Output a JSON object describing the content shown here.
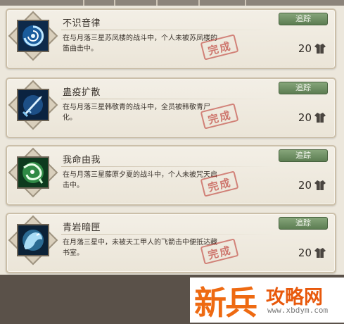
{
  "quests": [
    {
      "title": "不识音律",
      "description": "在与月落三星苏凤楼的战斗中，个人未被苏凤楼的笛曲击中。",
      "track_label": "追踪",
      "reward_amount": "20",
      "reward_icon": "coat-icon",
      "icon": "blue-vortex-icon",
      "stamp": "完成"
    },
    {
      "title": "蛊疫扩散",
      "description": "在与月落三星韩敬青的战斗中，全员被韩敬青尸化。",
      "track_label": "追踪",
      "reward_amount": "20",
      "reward_icon": "coat-icon",
      "icon": "blue-sword-icon",
      "stamp": "完成"
    },
    {
      "title": "我命由我",
      "description": "在与月落三星藤原夕夏的战斗中，个人未被咒天启击中。",
      "track_label": "追踪",
      "reward_amount": "20",
      "reward_icon": "coat-icon",
      "icon": "green-swirl-icon",
      "stamp": "完成"
    },
    {
      "title": "青岩暗匣",
      "description": "在月落三星中，未被天工甲人的飞箭击中便抵达藏书室。",
      "track_label": "追踪",
      "reward_amount": "20",
      "reward_icon": "coat-icon",
      "icon": "blue-beast-icon",
      "stamp": "完成"
    }
  ],
  "watermark": {
    "brand": "新兵",
    "site": "攻略网",
    "url": "www.xbdym.com"
  },
  "colors": {
    "track_button": "#6b8c60",
    "stamp": "#b92c24",
    "watermark": "#ee6a12"
  }
}
